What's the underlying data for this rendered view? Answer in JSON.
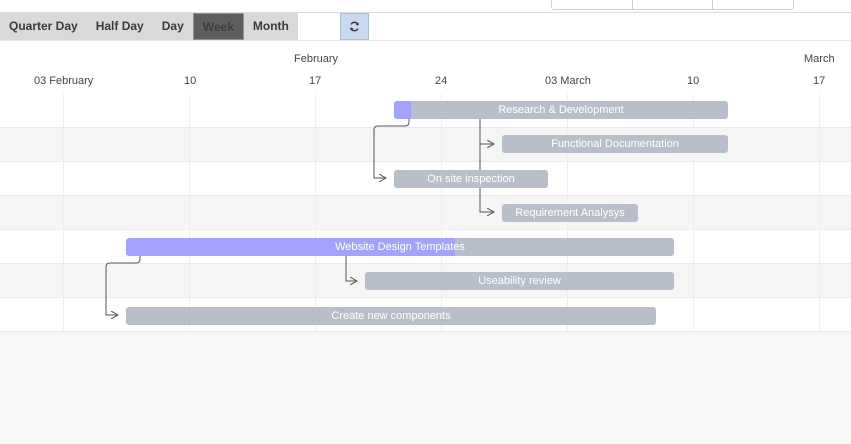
{
  "toolbar": {
    "view_modes": [
      "Quarter Day",
      "Half Day",
      "Day",
      "Week",
      "Month"
    ],
    "active_mode": "Week",
    "refresh_icon": "refresh-icon"
  },
  "timeline": {
    "upper": [
      "February",
      "March"
    ],
    "lower": [
      "03 February",
      "10",
      "17",
      "24",
      "03 March",
      "10",
      "17"
    ]
  },
  "tasks": [
    {
      "name": "Research & Development",
      "progress": 0.05
    },
    {
      "name": "Functional Documentation",
      "progress": 0
    },
    {
      "name": "On site inspection",
      "progress": 0
    },
    {
      "name": "Requirement Analysys",
      "progress": 0
    },
    {
      "name": "Website Design Templates",
      "progress": 0.6
    },
    {
      "name": "Useability review",
      "progress": 0
    },
    {
      "name": "Create new components",
      "progress": 0
    }
  ],
  "colors": {
    "bar": "#b8bfca",
    "progress": "#a3a3ff",
    "active_border": "#e07b39",
    "arrow": "#555555"
  }
}
